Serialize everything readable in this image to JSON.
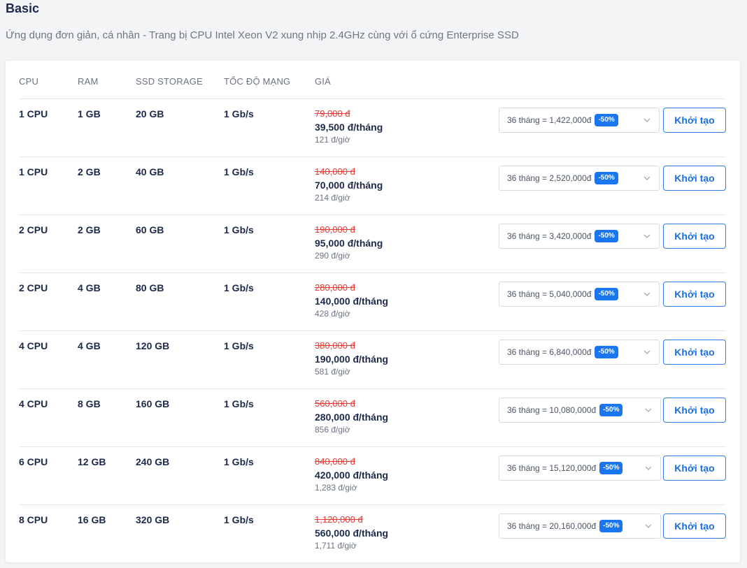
{
  "header": {
    "title": "Basic",
    "subtitle": "Ứng dụng đơn giản, cá nhân - Trang bị CPU Intel Xeon V2 xung nhịp 2.4GHz cùng với ổ cứng Enterprise SSD"
  },
  "table": {
    "columns": [
      "CPU",
      "RAM",
      "SSD STORAGE",
      "TỐC ĐỘ MẠNG",
      "GIÁ"
    ],
    "button_label": "Khởi tạo",
    "discount_badge": "-50%",
    "rows": [
      {
        "cpu": "1 CPU",
        "ram": "1 GB",
        "ssd": "20 GB",
        "net": "1 Gb/s",
        "old_price": "79,000 đ",
        "price": "39,500 đ/tháng",
        "hourly": "121 đ/giờ",
        "term": "36 tháng = 1,422,000đ"
      },
      {
        "cpu": "1 CPU",
        "ram": "2 GB",
        "ssd": "40 GB",
        "net": "1 Gb/s",
        "old_price": "140,000 đ",
        "price": "70,000 đ/tháng",
        "hourly": "214 đ/giờ",
        "term": "36 tháng = 2,520,000đ"
      },
      {
        "cpu": "2 CPU",
        "ram": "2 GB",
        "ssd": "60 GB",
        "net": "1 Gb/s",
        "old_price": "190,000 đ",
        "price": "95,000 đ/tháng",
        "hourly": "290 đ/giờ",
        "term": "36 tháng = 3,420,000đ"
      },
      {
        "cpu": "2 CPU",
        "ram": "4 GB",
        "ssd": "80 GB",
        "net": "1 Gb/s",
        "old_price": "280,000 đ",
        "price": "140,000 đ/tháng",
        "hourly": "428 đ/giờ",
        "term": "36 tháng = 5,040,000đ"
      },
      {
        "cpu": "4 CPU",
        "ram": "4 GB",
        "ssd": "120 GB",
        "net": "1 Gb/s",
        "old_price": "380,000 đ",
        "price": "190,000 đ/tháng",
        "hourly": "581 đ/giờ",
        "term": "36 tháng = 6,840,000đ"
      },
      {
        "cpu": "4 CPU",
        "ram": "8 GB",
        "ssd": "160 GB",
        "net": "1 Gb/s",
        "old_price": "560,000 đ",
        "price": "280,000 đ/tháng",
        "hourly": "856 đ/giờ",
        "term": "36 tháng = 10,080,000đ"
      },
      {
        "cpu": "6 CPU",
        "ram": "12 GB",
        "ssd": "240 GB",
        "net": "1 Gb/s",
        "old_price": "840,000 đ",
        "price": "420,000 đ/tháng",
        "hourly": "1,283 đ/giờ",
        "term": "36 tháng = 15,120,000đ"
      },
      {
        "cpu": "8 CPU",
        "ram": "16 GB",
        "ssd": "320 GB",
        "net": "1 Gb/s",
        "old_price": "1,120,000 đ",
        "price": "560,000 đ/tháng",
        "hourly": "1,711 đ/giờ",
        "term": "36 tháng = 20,160,000đ"
      }
    ]
  },
  "icons": {
    "select_chevron": "chevron-down-icon"
  },
  "colors": {
    "accent": "#1976f0",
    "old_price": "#e53935",
    "heading": "#1b2a4a"
  }
}
